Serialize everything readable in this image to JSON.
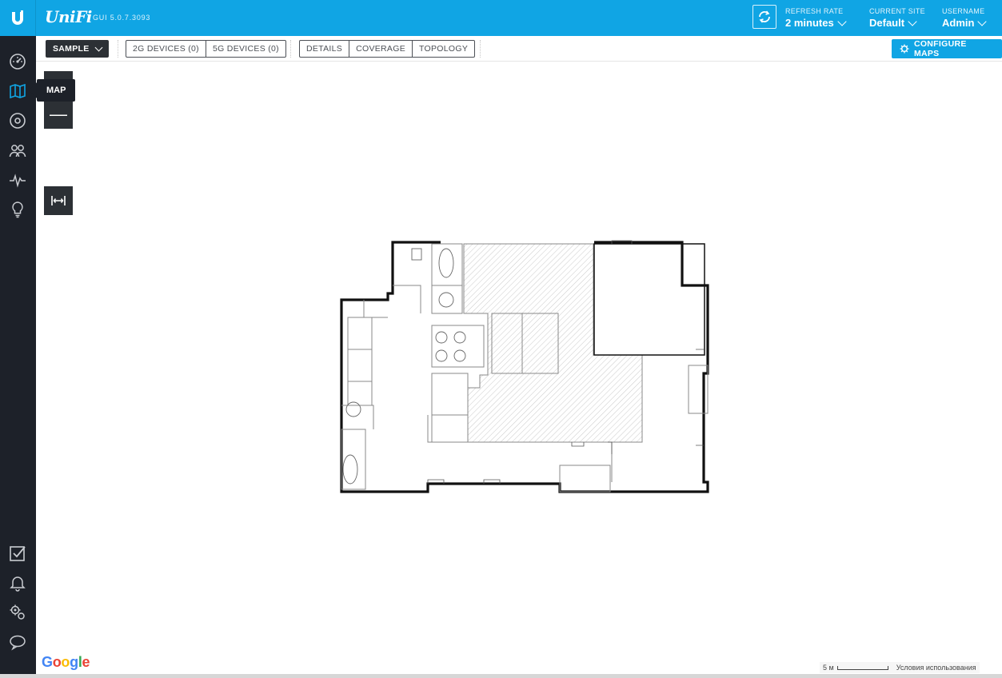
{
  "header": {
    "brand": "UniFi",
    "version": "GUI 5.0.7.3093",
    "refresh_rate": {
      "caption": "REFRESH RATE",
      "value": "2 minutes"
    },
    "current_site": {
      "caption": "CURRENT SITE",
      "value": "Default"
    },
    "username": {
      "caption": "USERNAME",
      "value": "Admin"
    },
    "accent": "#10a5e4"
  },
  "sidebar": {
    "items": [
      {
        "icon": "dashboard-icon"
      },
      {
        "icon": "map-icon",
        "active": true
      },
      {
        "icon": "devices-icon"
      },
      {
        "icon": "clients-icon"
      },
      {
        "icon": "statistics-icon"
      },
      {
        "icon": "insights-icon"
      }
    ],
    "bottom_items": [
      {
        "icon": "events-checklist-icon"
      },
      {
        "icon": "alerts-bell-icon"
      },
      {
        "icon": "settings-gears-icon"
      },
      {
        "icon": "chat-support-icon"
      }
    ],
    "tooltip": "MAP"
  },
  "toolbar": {
    "site_map": "SAMPLE",
    "device_filters": [
      "2G DEVICES (0)",
      "5G DEVICES (0)"
    ],
    "views": [
      "DETAILS",
      "COVERAGE",
      "TOPOLOGY"
    ],
    "configure_label": "CONFIGURE MAPS"
  },
  "map": {
    "zoom_out": "—",
    "google_logo": "Google",
    "scale_label": "5 м",
    "terms": "Условия использования"
  }
}
